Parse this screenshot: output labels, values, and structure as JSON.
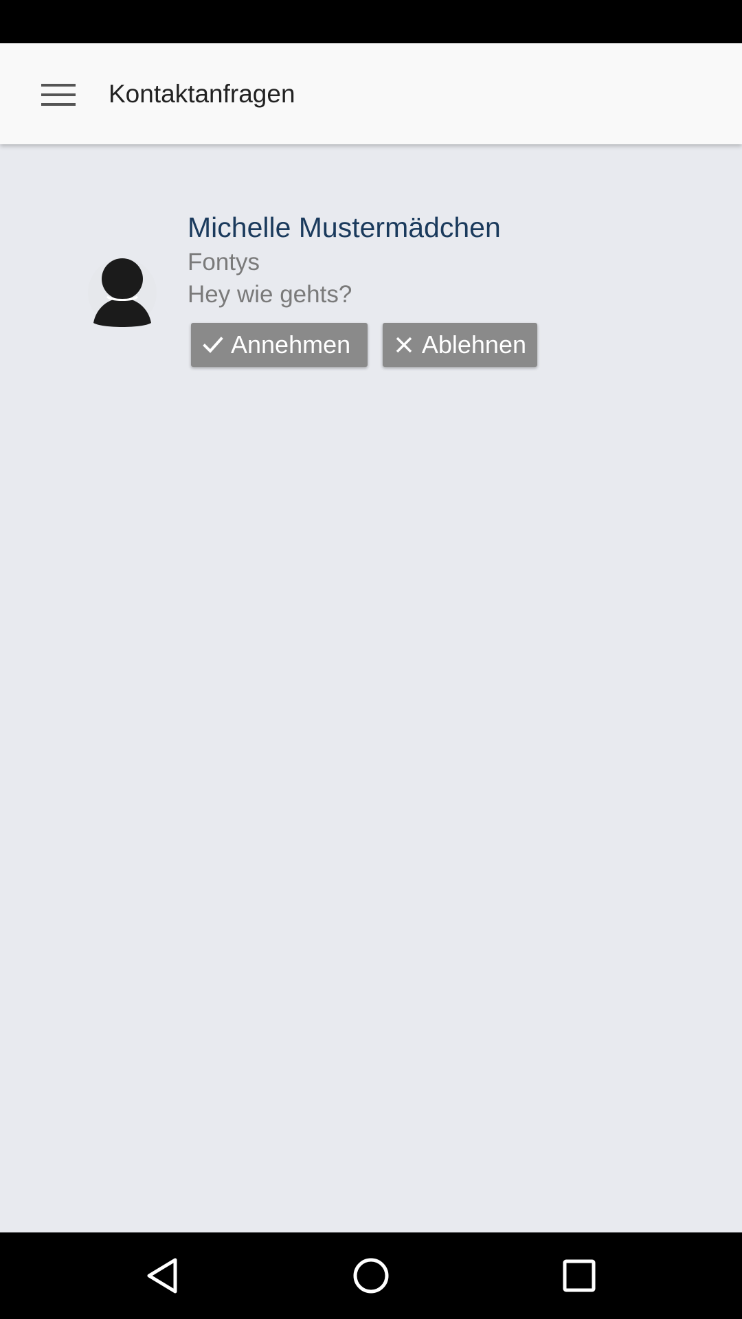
{
  "app_bar": {
    "title": "Kontaktanfragen",
    "menu_icon": "hamburger-menu-icon"
  },
  "requests": [
    {
      "name": "Michelle Mustermädchen",
      "organization": "Fontys",
      "message": "Hey wie gehts?",
      "avatar_icon": "person-silhouette-icon",
      "accept": {
        "icon": "check-icon",
        "label": "Annehmen"
      },
      "decline": {
        "icon": "close-icon",
        "label": "Ablehnen"
      }
    }
  ],
  "nav_bar": {
    "back_icon": "back-triangle-icon",
    "home_icon": "home-circle-icon",
    "recents_icon": "recents-square-icon"
  },
  "colors": {
    "app_bar_bg": "#f9f9f9",
    "content_bg": "#e8eaef",
    "name_color": "#1a3a5c",
    "secondary_text": "#7a7a7a",
    "button_bg": "#8a8a8a",
    "system_bars": "#000000"
  }
}
